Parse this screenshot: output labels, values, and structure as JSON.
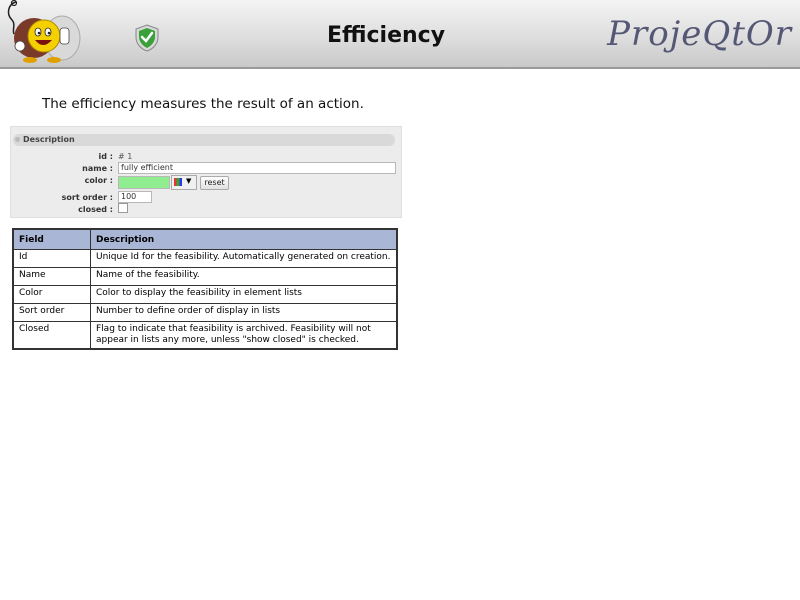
{
  "header": {
    "title": "Efficiency",
    "brand": "ProjeQtOr"
  },
  "intro": "The efficiency measures the result of an action.",
  "form": {
    "section_title": "Description",
    "id_label": "id :",
    "id_value": "# 1",
    "name_label": "name :",
    "name_value": "fully efficient",
    "color_label": "color :",
    "color_value": "#90EE90",
    "reset_label": "reset",
    "sort_label": "sort order :",
    "sort_value": "100",
    "closed_label": "closed :"
  },
  "table": {
    "headers": [
      "Field",
      "Description"
    ],
    "rows": [
      [
        "Id",
        "Unique Id for the feasibility. Automatically generated on creation."
      ],
      [
        "Name",
        "Name of the feasibility."
      ],
      [
        "Color",
        "Color to display the feasibility in element lists"
      ],
      [
        "Sort order",
        "Number to define order of display in lists"
      ],
      [
        "Closed",
        "Flag to indicate that feasibility is archived. Feasibility will not appear in lists any more, unless \"show closed\" is checked."
      ]
    ]
  }
}
